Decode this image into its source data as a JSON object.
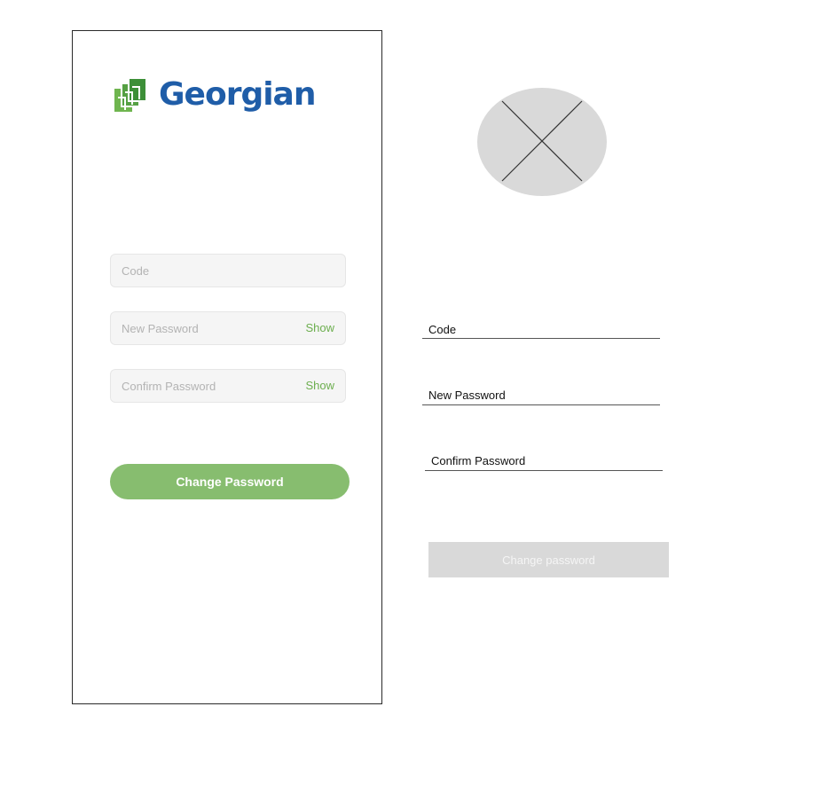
{
  "brand": {
    "name": "Georgian",
    "color": "#1f5da8",
    "accent": "#6fb54f"
  },
  "form": {
    "code_placeholder": "Code",
    "new_password_placeholder": "New Password",
    "confirm_password_placeholder": "Confirm Password",
    "show_label": "Show",
    "submit_label": "Change Password",
    "submit_color": "#87bd6f"
  },
  "wireframe": {
    "image_placeholder_icon": "image-placeholder-icon",
    "code_label": "Code",
    "new_password_label": "New Password",
    "confirm_password_label": "Confirm Password",
    "submit_label": "Change password"
  }
}
